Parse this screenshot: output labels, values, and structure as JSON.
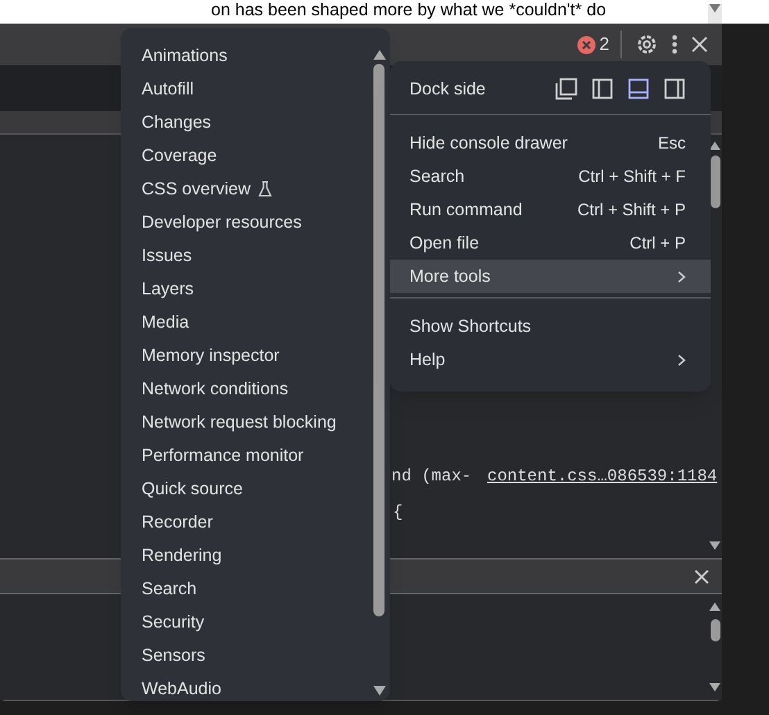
{
  "page_text": "on has been shaped more by what we *couldn't* do",
  "toolbar": {
    "error_count": "2"
  },
  "code": {
    "fragment": "nd (max-",
    "source_link": "content.css…086539:1184",
    "braces": [
      "{"
    ]
  },
  "more_tools_menu": [
    {
      "label": "Animations",
      "experimental": false
    },
    {
      "label": "Autofill",
      "experimental": false
    },
    {
      "label": "Changes",
      "experimental": false
    },
    {
      "label": "Coverage",
      "experimental": false
    },
    {
      "label": "CSS overview",
      "experimental": true
    },
    {
      "label": "Developer resources",
      "experimental": false
    },
    {
      "label": "Issues",
      "experimental": false
    },
    {
      "label": "Layers",
      "experimental": false
    },
    {
      "label": "Media",
      "experimental": false
    },
    {
      "label": "Memory inspector",
      "experimental": false
    },
    {
      "label": "Network conditions",
      "experimental": false
    },
    {
      "label": "Network request blocking",
      "experimental": false
    },
    {
      "label": "Performance monitor",
      "experimental": false
    },
    {
      "label": "Quick source",
      "experimental": false
    },
    {
      "label": "Recorder",
      "experimental": false
    },
    {
      "label": "Rendering",
      "experimental": false
    },
    {
      "label": "Search",
      "experimental": false
    },
    {
      "label": "Security",
      "experimental": false
    },
    {
      "label": "Sensors",
      "experimental": false
    },
    {
      "label": "WebAudio",
      "experimental": false
    }
  ],
  "main_menu": {
    "dock_side": {
      "label": "Dock side",
      "options": [
        {
          "kind": "undock",
          "selected": false
        },
        {
          "kind": "left",
          "selected": false
        },
        {
          "kind": "bottom",
          "selected": true
        },
        {
          "kind": "right",
          "selected": false
        }
      ]
    },
    "groups": [
      [
        {
          "label": "Hide console drawer",
          "shortcut": "Esc",
          "submenu": false,
          "selected": false
        },
        {
          "label": "Search",
          "shortcut": "Ctrl + Shift + F",
          "submenu": false,
          "selected": false
        },
        {
          "label": "Run command",
          "shortcut": "Ctrl + Shift + P",
          "submenu": false,
          "selected": false
        },
        {
          "label": "Open file",
          "shortcut": "Ctrl + P",
          "submenu": false,
          "selected": false
        },
        {
          "label": "More tools",
          "submenu": true,
          "selected": true
        }
      ],
      [
        {
          "label": "Show Shortcuts",
          "submenu": false,
          "selected": false
        },
        {
          "label": "Help",
          "submenu": true,
          "selected": false
        }
      ]
    ]
  }
}
